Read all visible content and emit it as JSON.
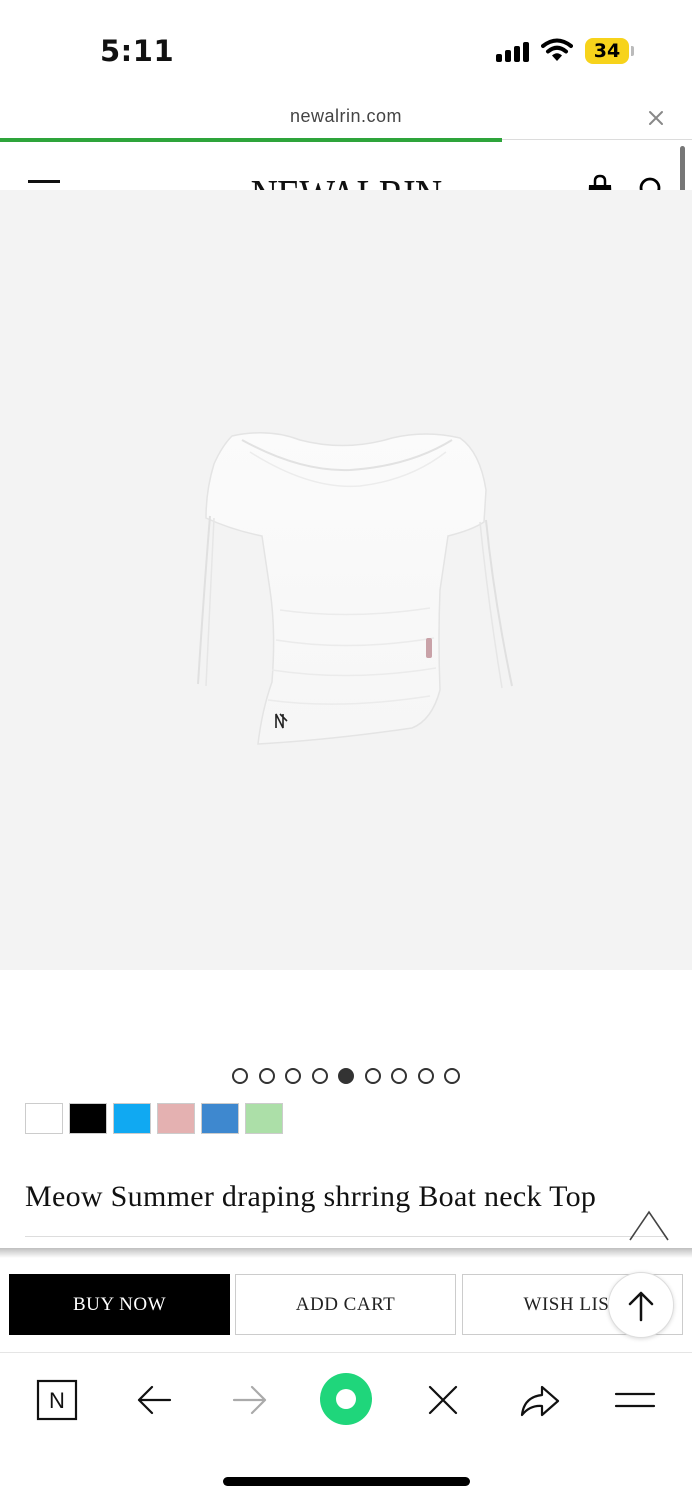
{
  "status_bar": {
    "time": "5:11",
    "battery": "34"
  },
  "browser": {
    "url": "newalrin.com",
    "load_progress": 0.725
  },
  "header": {
    "brand": "NEWALRIN"
  },
  "gallery": {
    "slide_count": 9,
    "active_index": 4,
    "image_alt": "White boat neck draping shirring top"
  },
  "swatches": [
    {
      "color": "#ffffff"
    },
    {
      "color": "#000000"
    },
    {
      "color": "#10a9f2"
    },
    {
      "color": "#e4b1b1"
    },
    {
      "color": "#3e88cf"
    },
    {
      "color": "#acdfa8"
    }
  ],
  "product": {
    "title": "Meow Summer draping shrring Boat neck Top"
  },
  "actions": {
    "buy_now": "BUY NOW",
    "add_cart": "ADD CART",
    "wish_list": "WISH LIST"
  },
  "toolbar": {
    "n_logo": "N"
  },
  "colors": {
    "progress": "#2ea43b",
    "primary_button": "#000000",
    "record_green": "#1fd67b"
  }
}
